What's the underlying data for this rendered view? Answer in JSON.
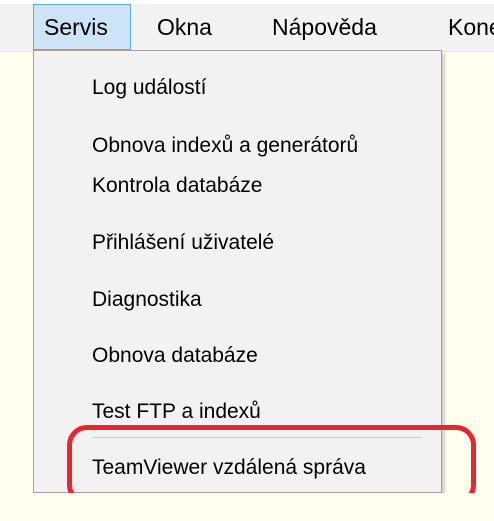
{
  "menubar": {
    "items": [
      {
        "label": "Servis"
      },
      {
        "label": "Okna"
      },
      {
        "label": "Nápověda"
      },
      {
        "label": "Konec"
      }
    ]
  },
  "dropdown": {
    "items": [
      {
        "label": "Log událostí"
      },
      {
        "label": "Obnova indexů a generátorů"
      },
      {
        "label": "Kontrola databáze"
      },
      {
        "label": "Přihlášení uživatelé"
      },
      {
        "label": "Diagnostika"
      },
      {
        "label": "Obnova databáze"
      },
      {
        "label": "Test FTP a indexů"
      },
      {
        "label": "TeamViewer vzdálená správa"
      }
    ]
  },
  "colors": {
    "highlight_border": "#e8262d",
    "active_menu_bg": "#cce4f7",
    "active_menu_border": "#6aa6da",
    "background": "#fffff0"
  }
}
